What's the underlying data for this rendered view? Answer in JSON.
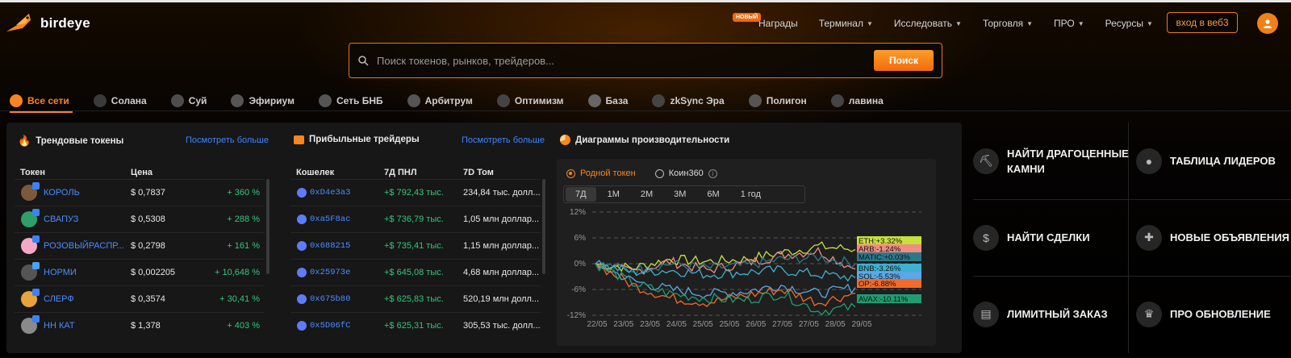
{
  "brand": {
    "name": "birdeye"
  },
  "header": {
    "nav": [
      {
        "label": "Награды",
        "badge": "НОВЫЙ",
        "caret": false
      },
      {
        "label": "Терминал",
        "caret": true
      },
      {
        "label": "Исследовать",
        "caret": true
      },
      {
        "label": "Торговля",
        "caret": true
      },
      {
        "label": "ПРО",
        "caret": true
      },
      {
        "label": "Ресурсы",
        "caret": true
      }
    ],
    "connect_label": "вход в веб3"
  },
  "search": {
    "placeholder": "Поиск токенов, рынков, трейдеров...",
    "button_label": "Поиск"
  },
  "chains": [
    {
      "label": "Все сети",
      "icon": "globe-icon",
      "color": "#f7861f",
      "active": true
    },
    {
      "label": "Солана",
      "icon": "solana-icon",
      "color": "#3a3a3a"
    },
    {
      "label": "Суй",
      "icon": "sui-icon",
      "color": "#4d4d4d"
    },
    {
      "label": "Эфириум",
      "icon": "ethereum-icon",
      "color": "#555555"
    },
    {
      "label": "Сеть БНБ",
      "icon": "bnb-icon",
      "color": "#555555"
    },
    {
      "label": "Арбитрум",
      "icon": "arbitrum-icon",
      "color": "#555555"
    },
    {
      "label": "Оптимизм",
      "icon": "optimism-icon",
      "color": "#444444"
    },
    {
      "label": "База",
      "icon": "base-icon",
      "color": "#666666"
    },
    {
      "label": "zkSync Эра",
      "icon": "zksync-icon",
      "color": "#444444"
    },
    {
      "label": "Полигон",
      "icon": "polygon-icon",
      "color": "#555555"
    },
    {
      "label": "лавина",
      "icon": "avalanche-icon",
      "color": "#444444"
    }
  ],
  "trending": {
    "title": "Трендовые токены",
    "see_more": "Посмотреть больше",
    "columns": [
      "Токен",
      "Цена"
    ],
    "rows": [
      {
        "name": "КОРОЛЬ",
        "price": "$ 0,7837",
        "change": "+ 360 %",
        "avatar_color": "#7a5a3a",
        "badge_color": "#3b82f6"
      },
      {
        "name": "СВАПУЗ",
        "price": "$ 0,5308",
        "change": "+ 288 %",
        "avatar_color": "#2f9e6a",
        "badge_color": "#3b82f6"
      },
      {
        "name": "РОЗОВЫЙРАСПР...",
        "price": "$ 0,2798",
        "change": "+ 161 %",
        "avatar_color": "#f3a9c5",
        "badge_color": "#3b82f6"
      },
      {
        "name": "НОРМИ",
        "price": "$ 0,002205",
        "change": "+ 10,648 %",
        "avatar_color": "#555555",
        "badge_color": "#4aa3ff"
      },
      {
        "name": "СЛЕРФ",
        "price": "$ 0,3574",
        "change": "+ 30,41 %",
        "avatar_color": "#e8a33a",
        "badge_color": "#3b82f6"
      },
      {
        "name": "НН КАТ",
        "price": "$ 1,378",
        "change": "+ 403 %",
        "avatar_color": "#8a8a8a",
        "badge_color": "#3b82f6"
      }
    ]
  },
  "traders": {
    "title": "Прибыльные трейдеры",
    "see_more": "Посмотреть больше",
    "columns": [
      "Кошелек",
      "7Д ПНЛ",
      "7D Том"
    ],
    "rows": [
      {
        "wallet": "0xD4e3a3",
        "pnl": "+$ 792,43 тыс.",
        "volume": "234,84 тыс. долл..."
      },
      {
        "wallet": "0xa5F8ac",
        "pnl": "+$ 736,79 тыс.",
        "volume": "1,05 млн доллар..."
      },
      {
        "wallet": "0x688215",
        "pnl": "+$ 735,41 тыс.",
        "volume": "1,15 млн доллар..."
      },
      {
        "wallet": "0x25973e",
        "pnl": "+$ 645,08 тыс.",
        "volume": "4,68 млн доллар..."
      },
      {
        "wallet": "0x675b80",
        "pnl": "+$ 625,83 тыс.",
        "volume": "520,19 млн долл..."
      },
      {
        "wallet": "0x5D06fC",
        "pnl": "+$ 625,31 тыс.",
        "volume": "305,53 тыс. долл..."
      }
    ]
  },
  "performance": {
    "title": "Диаграммы производительности",
    "radio": [
      {
        "label": "Родной токен",
        "selected": true
      },
      {
        "label": "Коин360",
        "selected": false
      }
    ],
    "ranges": [
      "7Д",
      "1М",
      "2М",
      "3М",
      "6М",
      "1 год"
    ],
    "active_range": "7Д"
  },
  "chart_data": {
    "type": "line",
    "x": [
      "22/05",
      "23/05",
      "24/05",
      "25/05",
      "26/05",
      "27/05",
      "28/05",
      "29/05"
    ],
    "x_tick_labels": [
      "22/05",
      "23/05",
      "23/05",
      "24/05",
      "25/05",
      "25/05",
      "26/05",
      "27/05",
      "27/05",
      "28/05",
      "29/05"
    ],
    "y_ticks": [
      "12%",
      "6%",
      "0%",
      "-6%",
      "-12%"
    ],
    "ylim": [
      -12,
      12
    ],
    "grid": true,
    "series": [
      {
        "name": "ETH",
        "label": "ETH:+3.32%",
        "color": "#c8e03a",
        "values": [
          0,
          -1,
          1,
          0.5,
          1,
          2.5,
          4,
          3.32
        ]
      },
      {
        "name": "ARB",
        "label": "ARB:-1.24%",
        "color": "#f28b82",
        "values": [
          0,
          -2,
          0.5,
          -1.5,
          0,
          2,
          3,
          -1.24
        ]
      },
      {
        "name": "MATIC",
        "label": "MATIC:+0.03%",
        "color": "#2b7a8a",
        "values": [
          0,
          -1.5,
          0,
          -1,
          -0.5,
          1,
          1.5,
          0.03
        ]
      },
      {
        "name": "BNB",
        "label": "BNB:-3.26%",
        "color": "#3fb0d0",
        "values": [
          0,
          -2,
          -1.5,
          -2.5,
          -2,
          -1.5,
          -2.5,
          -3.26
        ]
      },
      {
        "name": "SOL",
        "label": "SOL:-5.53%",
        "color": "#5aa9e6",
        "values": [
          0,
          -4,
          -6,
          -7,
          -6.5,
          -5,
          -7,
          -5.53
        ]
      },
      {
        "name": "OP",
        "label": "OP:-6.88%",
        "color": "#f26b2a",
        "values": [
          0,
          -5,
          -8,
          -9,
          -7.5,
          -6,
          -9,
          -6.88
        ]
      },
      {
        "name": "AVAX",
        "label": "AVAX:-10.11%",
        "color": "#1f9e72",
        "values": [
          0,
          -4.5,
          -7,
          -8,
          -8.5,
          -7,
          -11,
          -10.11
        ]
      }
    ]
  },
  "actions": [
    {
      "label": "НАЙТИ ДРАГОЦЕННЫЕ КАМНИ",
      "icon": "pickaxe-icon"
    },
    {
      "label": "ТАБЛИЦА ЛИДЕРОВ",
      "icon": "user-icon"
    },
    {
      "label": "НАЙТИ СДЕЛКИ",
      "icon": "coin-search-icon"
    },
    {
      "label": "НОВЫЕ ОБЪЯВЛЕНИЯ",
      "icon": "listing-icon"
    },
    {
      "label": "ЛИМИТНЫЙ ЗАКАЗ",
      "icon": "order-icon"
    },
    {
      "label": "ПРО ОБНОВЛЕНИЕ",
      "icon": "crown-icon"
    }
  ]
}
